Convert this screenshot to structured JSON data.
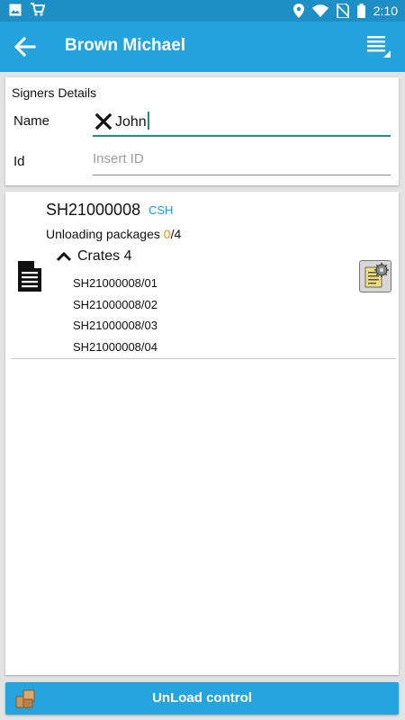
{
  "status_bar": {
    "time": "2:10",
    "icons_left": [
      "image-icon",
      "cart-icon"
    ],
    "icons_right": [
      "location-icon",
      "wifi-icon",
      "no-sim-icon",
      "battery-icon"
    ]
  },
  "appbar": {
    "title": "Brown Michael",
    "back_icon": "arrow-left-icon",
    "menu_icon": "list-menu-icon"
  },
  "signers": {
    "heading": "Signers Details",
    "name_label": "Name",
    "name_value": "John",
    "id_label": "Id",
    "id_placeholder": "Insert ID"
  },
  "shipment": {
    "code": "SH21000008",
    "tag": "CSH",
    "unloading_label": "Unloading packages",
    "unloading_done": "0",
    "unloading_sep_total": "/4",
    "crates_label": "Crates 4",
    "packages": [
      "SH21000008/01",
      "SH21000008/02",
      "SH21000008/03",
      "SH21000008/04"
    ]
  },
  "footer": {
    "button_label": "UnLoad control"
  },
  "colors": {
    "status_bar": "#1d8fc4",
    "app_bar": "#24a3dc",
    "accent_text": "#1e9ad6",
    "count_orange": "#f18a00",
    "field_underline": "#1f8f7a"
  }
}
